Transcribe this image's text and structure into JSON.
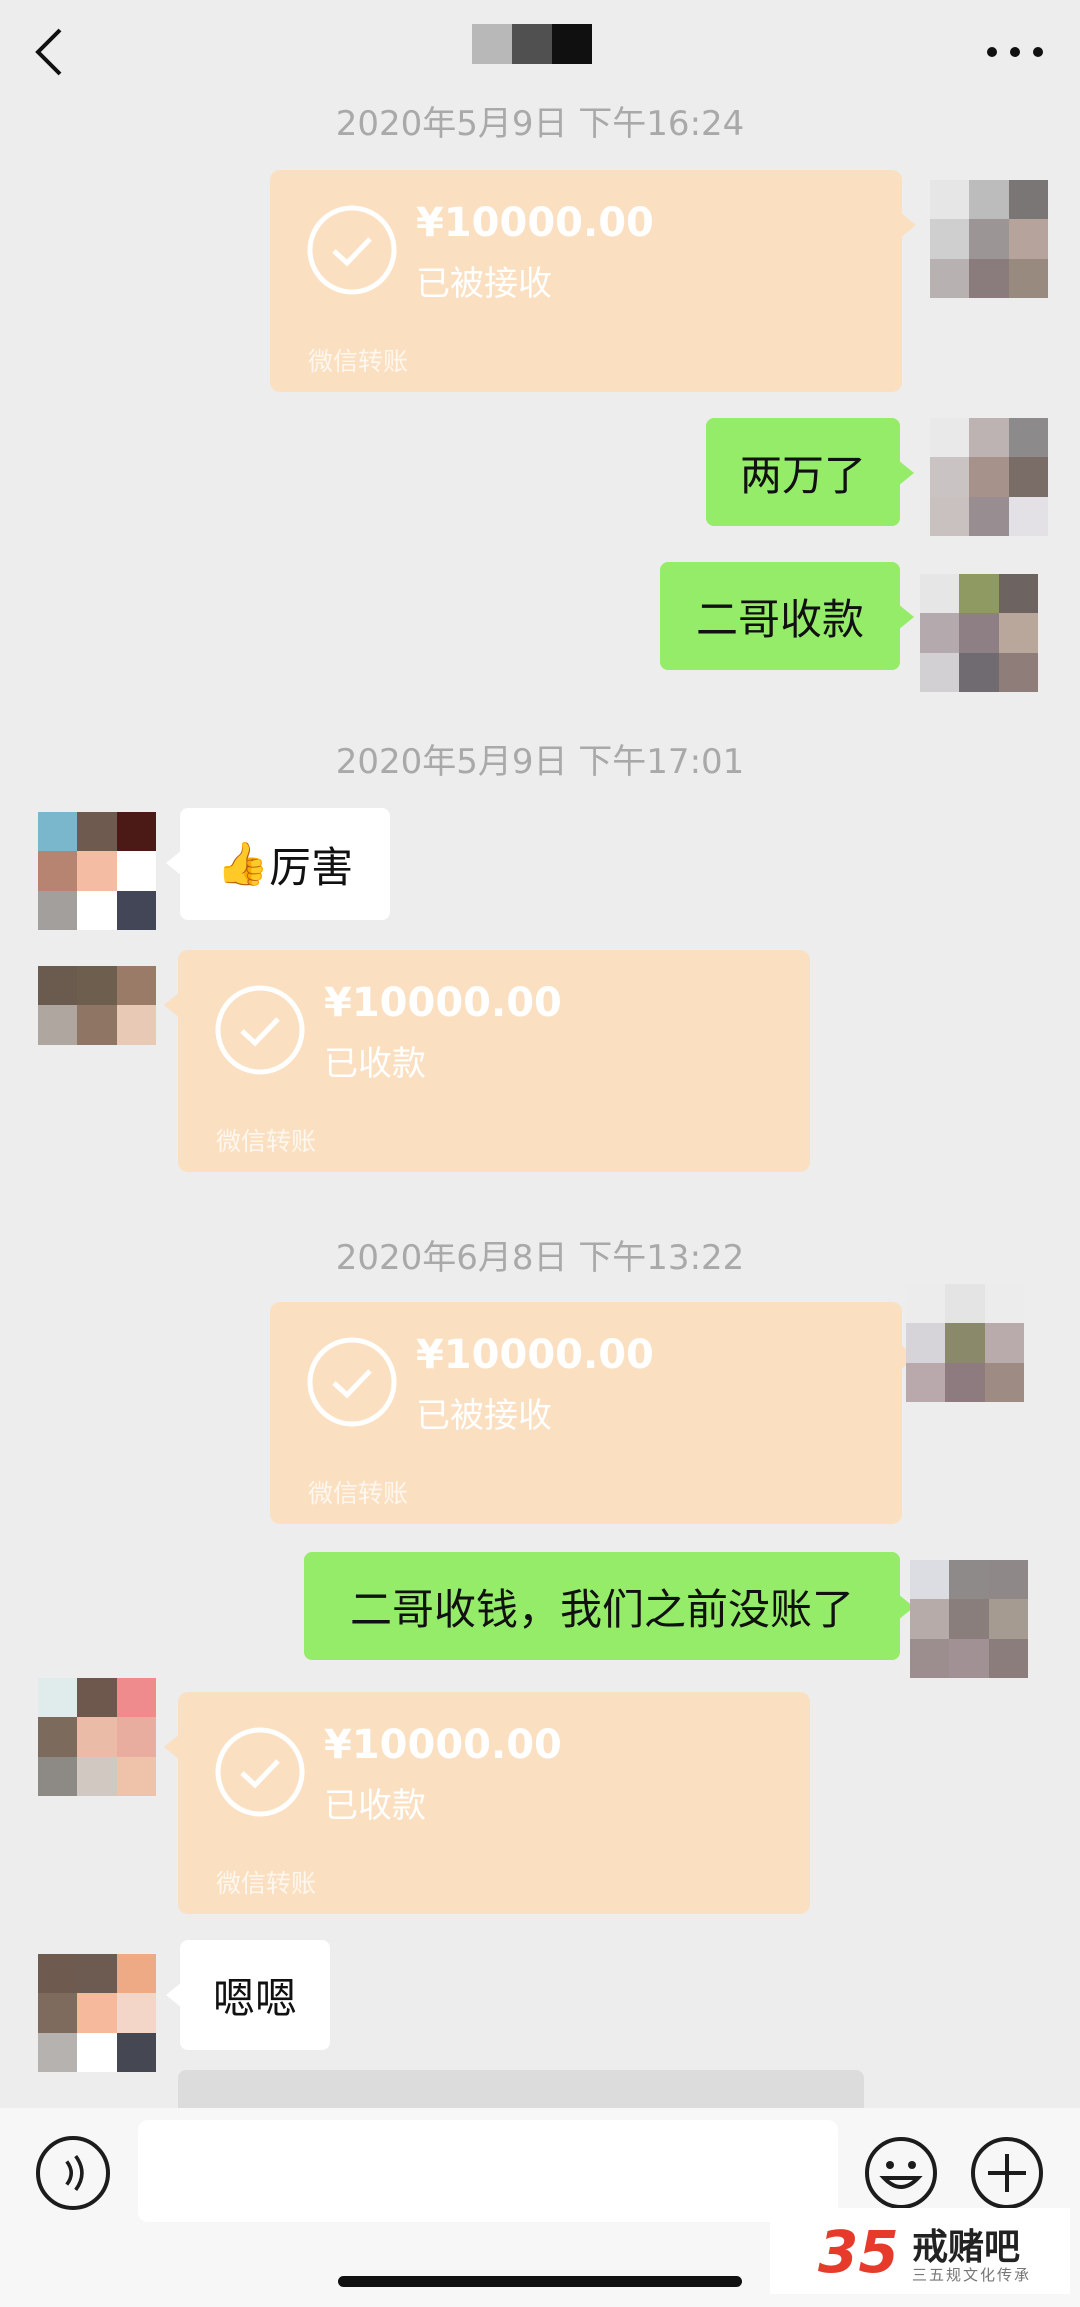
{
  "header": {
    "back_icon": "chevron-left-icon",
    "more_icon": "more-dots-icon",
    "title_colors": [
      "#b8b8b8",
      "#505050",
      "#101010"
    ]
  },
  "messages": {
    "ts1": "2020年5月9日 下午16:24",
    "t1_amount": "¥10000.00",
    "t1_status": "已被接收",
    "t1_source": "微信转账",
    "m1": "两万了",
    "m2": "二哥收款",
    "ts2": "2020年5月9日 下午17:01",
    "m3_emoji": "👍",
    "m3_text": "厉害",
    "t2_amount": "¥10000.00",
    "t2_status": "已收款",
    "t2_source": "微信转账",
    "ts3": "2020年6月8日 下午13:22",
    "t3_amount": "¥10000.00",
    "t3_status": "已被接收",
    "t3_source": "微信转账",
    "m4": "二哥收钱，我们之前没账了",
    "t4_amount": "¥10000.00",
    "t4_status": "已收款",
    "t4_source": "微信转账",
    "m5": "嗯嗯"
  },
  "input_bar": {
    "voice_icon": "voice-icon",
    "emoji_icon": "emoji-icon",
    "plus_icon": "plus-icon",
    "text_value": ""
  },
  "watermark": {
    "number": "35",
    "name": "戒赌吧",
    "subtitle": "三五规文化传承"
  },
  "colors": {
    "background": "#ededed",
    "green_bubble": "#95ec69",
    "transfer_bubble": "#fbdfc1"
  }
}
